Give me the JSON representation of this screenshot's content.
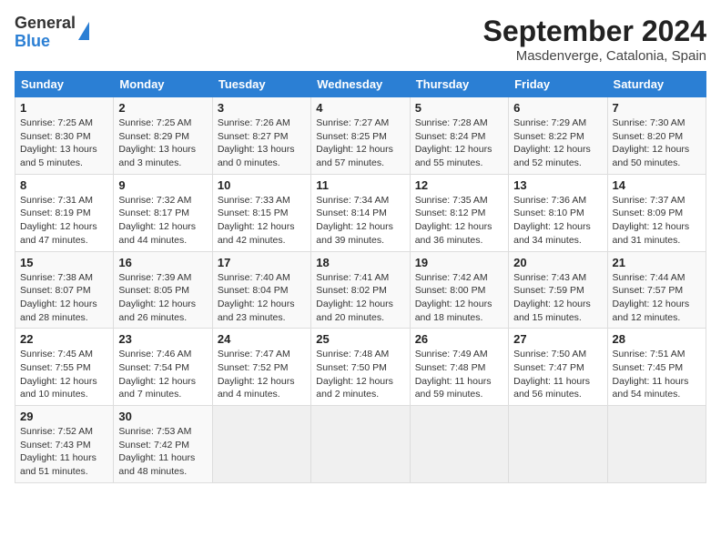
{
  "header": {
    "logo_general": "General",
    "logo_blue": "Blue",
    "month_title": "September 2024",
    "location": "Masdenverge, Catalonia, Spain"
  },
  "days_of_week": [
    "Sunday",
    "Monday",
    "Tuesday",
    "Wednesday",
    "Thursday",
    "Friday",
    "Saturday"
  ],
  "weeks": [
    [
      {
        "day": "1",
        "info": "Sunrise: 7:25 AM\nSunset: 8:30 PM\nDaylight: 13 hours\nand 5 minutes."
      },
      {
        "day": "2",
        "info": "Sunrise: 7:25 AM\nSunset: 8:29 PM\nDaylight: 13 hours\nand 3 minutes."
      },
      {
        "day": "3",
        "info": "Sunrise: 7:26 AM\nSunset: 8:27 PM\nDaylight: 13 hours\nand 0 minutes."
      },
      {
        "day": "4",
        "info": "Sunrise: 7:27 AM\nSunset: 8:25 PM\nDaylight: 12 hours\nand 57 minutes."
      },
      {
        "day": "5",
        "info": "Sunrise: 7:28 AM\nSunset: 8:24 PM\nDaylight: 12 hours\nand 55 minutes."
      },
      {
        "day": "6",
        "info": "Sunrise: 7:29 AM\nSunset: 8:22 PM\nDaylight: 12 hours\nand 52 minutes."
      },
      {
        "day": "7",
        "info": "Sunrise: 7:30 AM\nSunset: 8:20 PM\nDaylight: 12 hours\nand 50 minutes."
      }
    ],
    [
      {
        "day": "8",
        "info": "Sunrise: 7:31 AM\nSunset: 8:19 PM\nDaylight: 12 hours\nand 47 minutes."
      },
      {
        "day": "9",
        "info": "Sunrise: 7:32 AM\nSunset: 8:17 PM\nDaylight: 12 hours\nand 44 minutes."
      },
      {
        "day": "10",
        "info": "Sunrise: 7:33 AM\nSunset: 8:15 PM\nDaylight: 12 hours\nand 42 minutes."
      },
      {
        "day": "11",
        "info": "Sunrise: 7:34 AM\nSunset: 8:14 PM\nDaylight: 12 hours\nand 39 minutes."
      },
      {
        "day": "12",
        "info": "Sunrise: 7:35 AM\nSunset: 8:12 PM\nDaylight: 12 hours\nand 36 minutes."
      },
      {
        "day": "13",
        "info": "Sunrise: 7:36 AM\nSunset: 8:10 PM\nDaylight: 12 hours\nand 34 minutes."
      },
      {
        "day": "14",
        "info": "Sunrise: 7:37 AM\nSunset: 8:09 PM\nDaylight: 12 hours\nand 31 minutes."
      }
    ],
    [
      {
        "day": "15",
        "info": "Sunrise: 7:38 AM\nSunset: 8:07 PM\nDaylight: 12 hours\nand 28 minutes."
      },
      {
        "day": "16",
        "info": "Sunrise: 7:39 AM\nSunset: 8:05 PM\nDaylight: 12 hours\nand 26 minutes."
      },
      {
        "day": "17",
        "info": "Sunrise: 7:40 AM\nSunset: 8:04 PM\nDaylight: 12 hours\nand 23 minutes."
      },
      {
        "day": "18",
        "info": "Sunrise: 7:41 AM\nSunset: 8:02 PM\nDaylight: 12 hours\nand 20 minutes."
      },
      {
        "day": "19",
        "info": "Sunrise: 7:42 AM\nSunset: 8:00 PM\nDaylight: 12 hours\nand 18 minutes."
      },
      {
        "day": "20",
        "info": "Sunrise: 7:43 AM\nSunset: 7:59 PM\nDaylight: 12 hours\nand 15 minutes."
      },
      {
        "day": "21",
        "info": "Sunrise: 7:44 AM\nSunset: 7:57 PM\nDaylight: 12 hours\nand 12 minutes."
      }
    ],
    [
      {
        "day": "22",
        "info": "Sunrise: 7:45 AM\nSunset: 7:55 PM\nDaylight: 12 hours\nand 10 minutes."
      },
      {
        "day": "23",
        "info": "Sunrise: 7:46 AM\nSunset: 7:54 PM\nDaylight: 12 hours\nand 7 minutes."
      },
      {
        "day": "24",
        "info": "Sunrise: 7:47 AM\nSunset: 7:52 PM\nDaylight: 12 hours\nand 4 minutes."
      },
      {
        "day": "25",
        "info": "Sunrise: 7:48 AM\nSunset: 7:50 PM\nDaylight: 12 hours\nand 2 minutes."
      },
      {
        "day": "26",
        "info": "Sunrise: 7:49 AM\nSunset: 7:48 PM\nDaylight: 11 hours\nand 59 minutes."
      },
      {
        "day": "27",
        "info": "Sunrise: 7:50 AM\nSunset: 7:47 PM\nDaylight: 11 hours\nand 56 minutes."
      },
      {
        "day": "28",
        "info": "Sunrise: 7:51 AM\nSunset: 7:45 PM\nDaylight: 11 hours\nand 54 minutes."
      }
    ],
    [
      {
        "day": "29",
        "info": "Sunrise: 7:52 AM\nSunset: 7:43 PM\nDaylight: 11 hours\nand 51 minutes."
      },
      {
        "day": "30",
        "info": "Sunrise: 7:53 AM\nSunset: 7:42 PM\nDaylight: 11 hours\nand 48 minutes."
      },
      {
        "day": "",
        "info": ""
      },
      {
        "day": "",
        "info": ""
      },
      {
        "day": "",
        "info": ""
      },
      {
        "day": "",
        "info": ""
      },
      {
        "day": "",
        "info": ""
      }
    ]
  ]
}
